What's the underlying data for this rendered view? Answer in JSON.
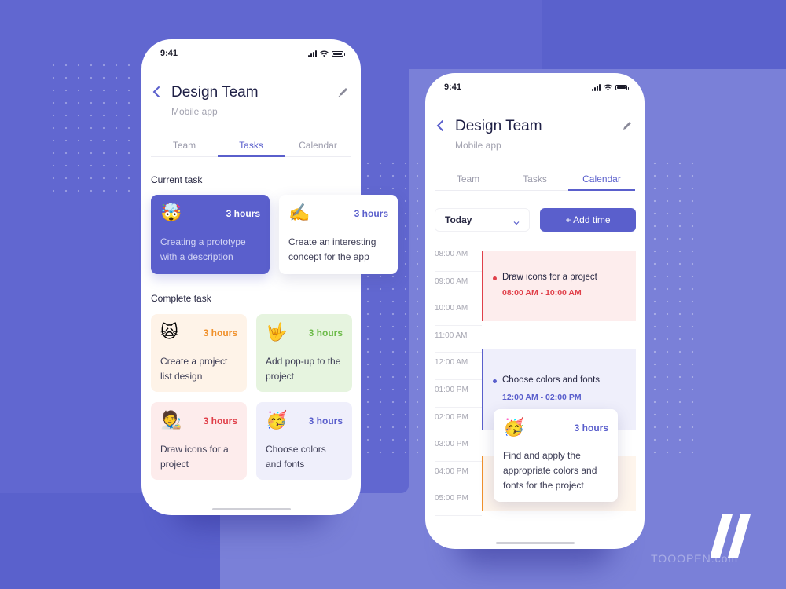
{
  "colors": {
    "accent": "#5a5fcc",
    "background": "#6167d0",
    "panel": "#7a80d8",
    "orange": "#f0912c",
    "green": "#6dbb4a",
    "red": "#e0404a",
    "purple": "#5a5fcc"
  },
  "phone_tasks": {
    "status_time": "9:41",
    "title": "Design Team",
    "subtitle": "Mobile app",
    "back_icon": "chevron-left-icon",
    "edit_icon": "pencil-icon",
    "tabs": [
      {
        "label": "Team",
        "active": false
      },
      {
        "label": "Tasks",
        "active": true
      },
      {
        "label": "Calendar",
        "active": false
      }
    ],
    "current_section_label": "Current task",
    "current_tasks": [
      {
        "emoji": "🤯",
        "hours": "3 hours",
        "description": "Creating a prototype with a description",
        "style": "active"
      },
      {
        "emoji": "✍️",
        "hours": "3 hours",
        "description": "Create an interesting concept for the app",
        "style": "white"
      }
    ],
    "complete_section_label": "Complete task",
    "complete_tasks": [
      {
        "emoji": "🙀",
        "hours": "3 hours",
        "description": "Create a project list design",
        "color": "orange"
      },
      {
        "emoji": "🤟",
        "hours": "3 hours",
        "description": "Add pop-up to the project",
        "color": "green"
      },
      {
        "emoji": "🧑‍🎨",
        "hours": "3 hours",
        "description": "Draw icons for a project",
        "color": "red"
      },
      {
        "emoji": "🥳",
        "hours": "3 hours",
        "description": "Choose colors and fonts",
        "color": "purple"
      }
    ]
  },
  "phone_calendar": {
    "status_time": "9:41",
    "title": "Design Team",
    "subtitle": "Mobile app",
    "back_icon": "chevron-left-icon",
    "edit_icon": "pencil-icon",
    "tabs": [
      {
        "label": "Team",
        "active": false
      },
      {
        "label": "Tasks",
        "active": false
      },
      {
        "label": "Calendar",
        "active": true
      }
    ],
    "date_select": {
      "value": "Today"
    },
    "add_time_label": "+ Add time",
    "time_slots": [
      "08:00 AM",
      "09:00 AM",
      "10:00 AM",
      "11:00 AM",
      "12:00 AM",
      "01:00 PM",
      "02:00 PM",
      "03:00 PM",
      "04:00 PM",
      "05:00 PM"
    ],
    "events": [
      {
        "name": "Draw icons for a project",
        "range": "08:00 AM - 10:00 AM",
        "color": "red"
      },
      {
        "name": "Choose colors and fonts",
        "range": "12:00 AM - 02:00 PM",
        "color": "purple"
      },
      {
        "name": "",
        "range": "",
        "color": "orange"
      }
    ],
    "popup": {
      "emoji": "🥳",
      "hours": "3 hours",
      "description": "Find and apply the appropriate colors and fonts for the project"
    }
  },
  "watermark": "TOOOPEN.com"
}
